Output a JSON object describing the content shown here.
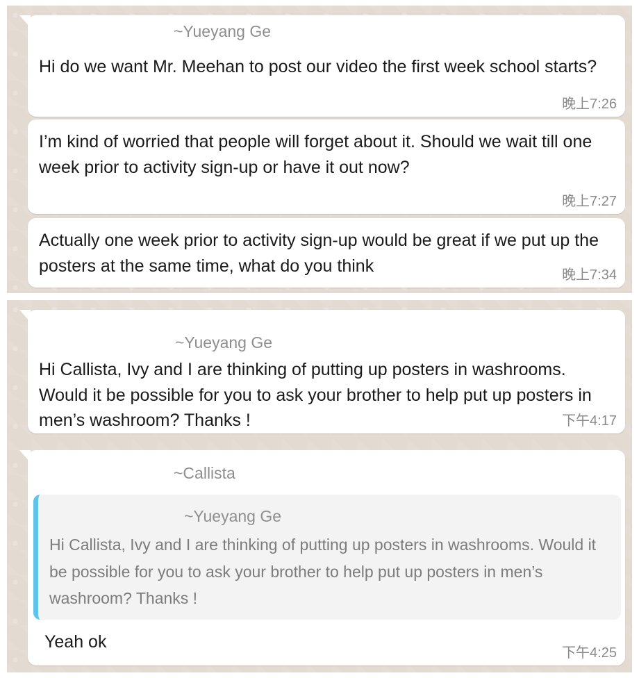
{
  "panel1": {
    "messages": [
      {
        "sender": "~Yueyang Ge",
        "text": "Hi do we want Mr. Meehan to post our video the first week school starts?",
        "time": "晚上7:26"
      },
      {
        "text": "I’m kind of worried that people will forget about it. Should we wait till one week prior to activity sign-up or have it out now?",
        "time": "晚上7:27"
      },
      {
        "text": "Actually one week prior to activity sign-up would be great if we put up the posters at the same time, what do you think",
        "time": "晚上7:34"
      }
    ]
  },
  "panel2": {
    "messages": [
      {
        "sender": "~Yueyang Ge",
        "text": "Hi Callista, Ivy and I are thinking of putting up posters in washrooms. Would it be possible for you to ask your brother to help put up posters in men’s washroom? Thanks !",
        "time": "下午4:17"
      },
      {
        "sender": "~Callista",
        "quote": {
          "sender": "~Yueyang Ge",
          "text": "Hi Callista, Ivy and I are thinking of putting up posters in washrooms. Would it be possible for you to ask your brother to help put up posters in men’s washroom? Thanks !"
        },
        "text": "Yeah ok",
        "time": "下午4:25"
      }
    ]
  },
  "colors": {
    "chat_background": "#e3dbd2",
    "bubble": "#ffffff",
    "quote_bar": "#5ec4ea",
    "quote_background": "#f3f3f3",
    "sender_text": "#8e8e8e",
    "timestamp": "#8a8a8a"
  }
}
